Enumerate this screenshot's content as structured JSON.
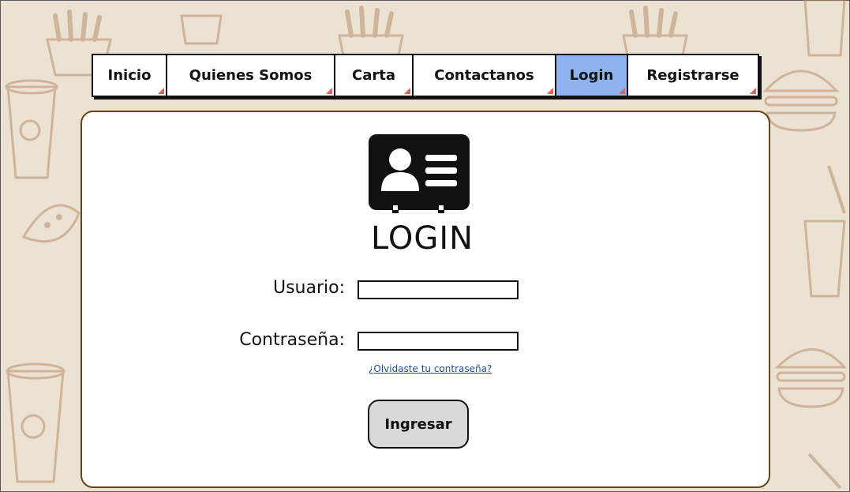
{
  "nav": {
    "items": [
      {
        "label": "Inicio",
        "active": false
      },
      {
        "label": "Quienes Somos",
        "active": false
      },
      {
        "label": "Carta",
        "active": false
      },
      {
        "label": "Contactanos",
        "active": false
      },
      {
        "label": "Login",
        "active": true
      },
      {
        "label": "Registrarse",
        "active": false
      }
    ]
  },
  "login": {
    "icon": "id-card-icon",
    "title": "LOGIN",
    "username_label": "Usuario:",
    "username_value": "",
    "password_label": "Contraseña:",
    "password_value": "",
    "forgot_link": "¿Olvidaste tu contraseña?",
    "submit_label": "Ingresar"
  },
  "colors": {
    "background": "#ece2d4",
    "active_tab": "#8fb3ee",
    "card_border": "#6a4313",
    "button_bg": "#d9d9d9",
    "link": "#1d4f8f"
  }
}
